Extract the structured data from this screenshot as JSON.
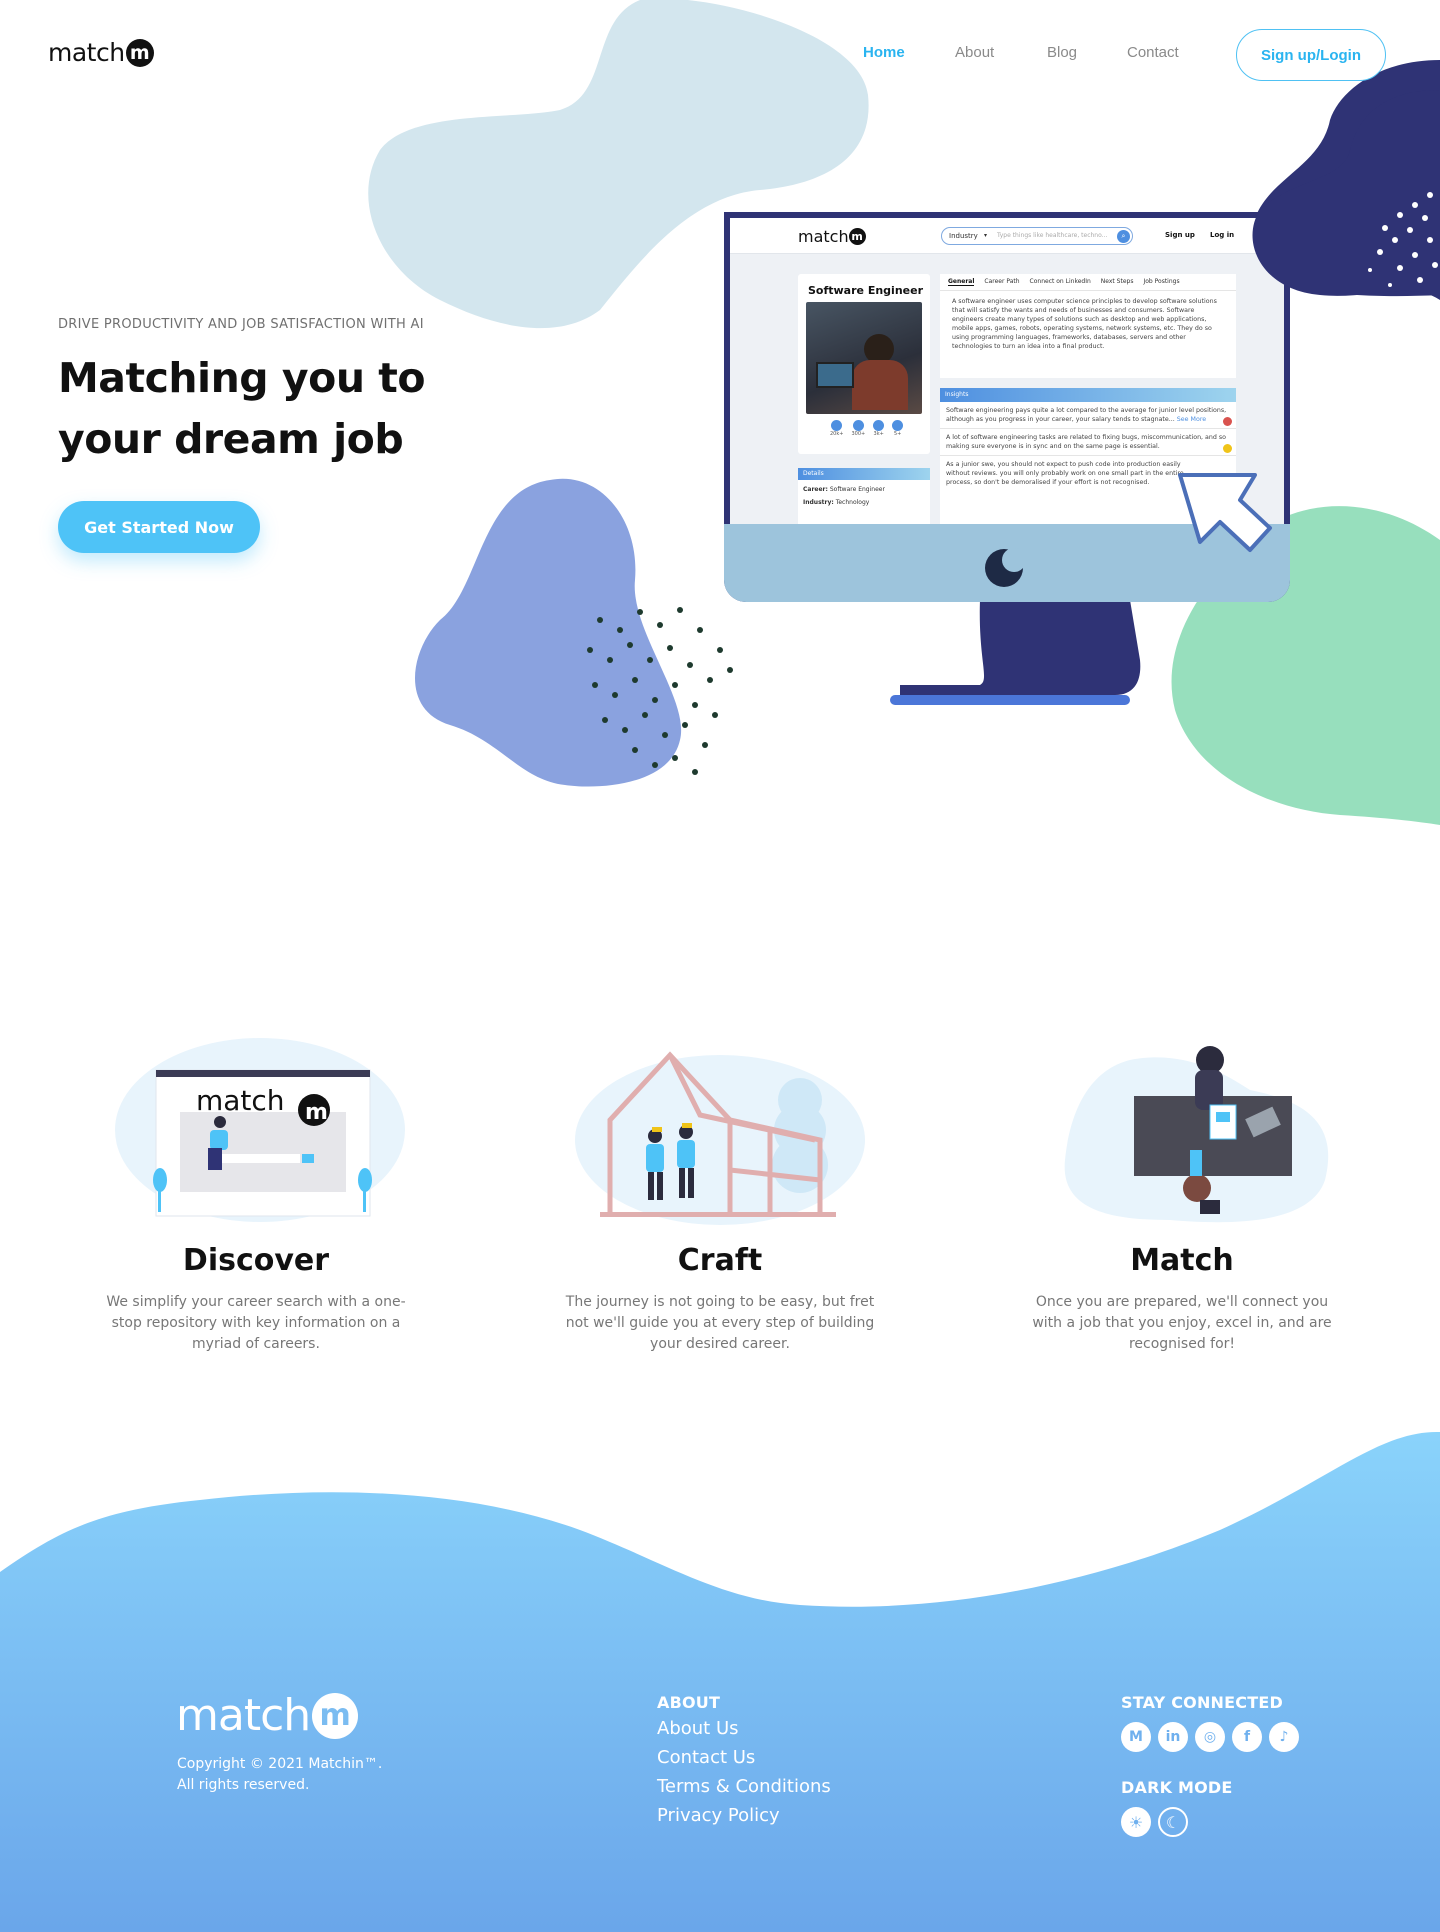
{
  "brand": {
    "name": "match",
    "badge": "m"
  },
  "nav": {
    "items": [
      "Home",
      "About",
      "Blog",
      "Contact"
    ],
    "signup_label": "Sign up/Login"
  },
  "hero": {
    "eyebrow": "DRIVE PRODUCTIVITY AND JOB SATISFACTION WITH AI",
    "title": "Matching you to your dream job",
    "cta_label": "Get Started Now"
  },
  "mock": {
    "logo": "match",
    "industry_select": "Industry",
    "search_placeholder": "Type things like healthcare, techno...",
    "signup": "Sign up",
    "login": "Log in",
    "job_title": "Software Engineer",
    "stats": [
      "20k+",
      "300+",
      "3k+",
      "5+"
    ],
    "details_header": "Details",
    "career_label": "Career:",
    "career_value": "Software Engineer",
    "industry_label": "Industry:",
    "industry_value": "Technology",
    "tabs": [
      "General",
      "Career Path",
      "Connect on LinkedIn",
      "Next Steps",
      "Job Postings"
    ],
    "general_text": "A software engineer uses computer science principles to develop software solutions that will satisfy the wants and needs of businesses and consumers. Software engineers create many types of solutions such as desktop and web applications, mobile apps, games, robots, operating systems, network systems, etc. They do so using programming languages, frameworks, databases, servers and other technologies to turn an idea into a final product.",
    "insights_header": "Insights",
    "insights": [
      {
        "text": "Software engineering pays quite a lot compared to the average for junior level positions, although as you progress in your career, your salary tends to stagnate...",
        "more": "See More",
        "color": "#d9534f"
      },
      {
        "text": "A lot of software engineering tasks are related to fixing bugs, miscommunication, and so making sure everyone is in sync and on the same page is essential.",
        "more": "",
        "color": "#f0c419"
      },
      {
        "text": "As a junior swe, you should not expect to push code into production easily without reviews. you will only probably work on one small part in the entire process, so don't be demoralised if your effort is not recognised.",
        "more": "",
        "color": ""
      }
    ]
  },
  "features": [
    {
      "title": "Discover",
      "desc": "We simplify your career search with a one-stop repository with key information on a myriad of careers."
    },
    {
      "title": "Craft",
      "desc": "The journey is not going to be easy, but fret not we'll guide you at every step of building your desired career."
    },
    {
      "title": "Match",
      "desc": "Once you are prepared, we'll connect you with a job that you enjoy, excel in, and are recognised for!"
    }
  ],
  "footer": {
    "copyright": "Copyright © 2021 Matchin™.",
    "rights": "All rights reserved.",
    "about_head": "ABOUT",
    "links": [
      "About Us",
      "Contact Us",
      "Terms & Conditions",
      "Privacy Policy"
    ],
    "stay_head": "STAY CONNECTED",
    "social": [
      "medium-icon",
      "linkedin-icon",
      "instagram-icon",
      "facebook-icon",
      "tiktok-icon"
    ],
    "social_glyphs": [
      "M",
      "in",
      "◎",
      "f",
      "♪"
    ],
    "dark_head": "DARK MODE",
    "mode_glyphs": [
      "☀",
      "☾"
    ]
  },
  "colors": {
    "accent": "#2ab4f0",
    "cta": "#4ec3f7",
    "navy": "#2f3375",
    "mint": "#97dfbd",
    "periwinkle": "#8aa2df",
    "paleblue": "#d3e6ee",
    "footer_top": "#8ad3fb",
    "footer_bottom": "#6aa6ea"
  }
}
